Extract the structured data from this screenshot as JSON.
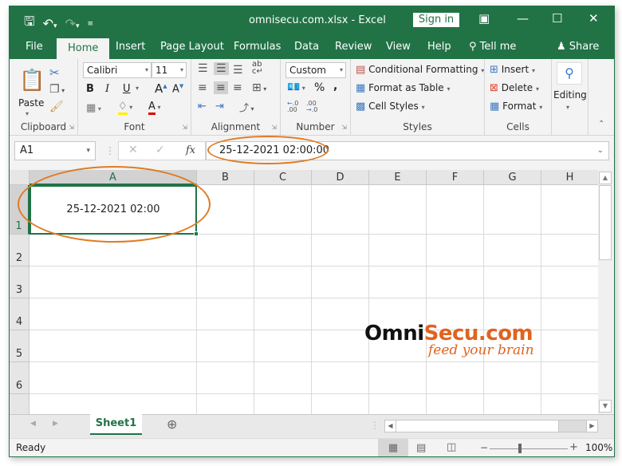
{
  "window": {
    "title": "omnisecu.com.xlsx  -  Excel",
    "sign_in": "Sign in",
    "accent": "#217346"
  },
  "qat": {
    "save": "save-icon",
    "undo": "undo-icon",
    "redo": "redo-icon",
    "customize": "customize-qat-icon"
  },
  "tabs": [
    "File",
    "Home",
    "Insert",
    "Page Layout",
    "Formulas",
    "Data",
    "Review",
    "View",
    "Help",
    "Tell me",
    "Share"
  ],
  "ribbon": {
    "clipboard": {
      "label": "Clipboard",
      "paste": "Paste"
    },
    "font": {
      "label": "Font",
      "name": "Calibri",
      "size": "11",
      "bold": "B",
      "italic": "I",
      "underline": "U"
    },
    "alignment": {
      "label": "Alignment"
    },
    "number": {
      "label": "Number",
      "format": "Custom",
      "percent": "%",
      "comma": ","
    },
    "styles": {
      "label": "Styles",
      "conditional": "Conditional Formatting",
      "table": "Format as Table",
      "cell": "Cell Styles"
    },
    "cells": {
      "label": "Cells",
      "insert": "Insert",
      "delete": "Delete",
      "format": "Format"
    },
    "editing": {
      "label": "Editing"
    }
  },
  "formula_bar": {
    "name_box": "A1",
    "fx": "fx",
    "value": "25-12-2021  02:00:00"
  },
  "grid": {
    "columns": [
      "A",
      "B",
      "C",
      "D",
      "E",
      "F",
      "G",
      "H"
    ],
    "rows": [
      "1",
      "2",
      "3",
      "4",
      "5",
      "6"
    ],
    "cells": {
      "A1": "25-12-2021 02:00"
    }
  },
  "logo": {
    "part1": "Omni",
    "part2": "Secu.com",
    "tagline": "feed your brain",
    "color1": "#111111",
    "color2": "#e0631f"
  },
  "sheets": [
    "Sheet1"
  ],
  "status": {
    "text": "Ready",
    "zoom": "100%",
    "zoom_level_percent": 100
  }
}
